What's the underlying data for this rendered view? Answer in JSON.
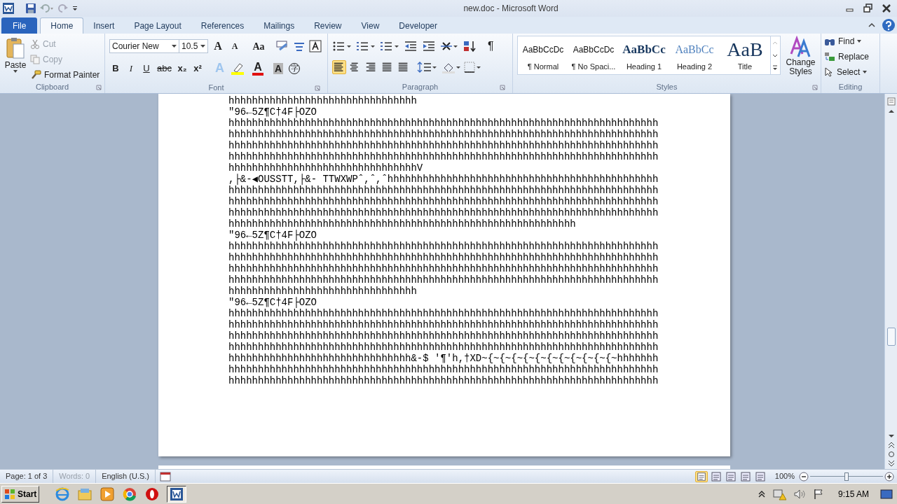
{
  "window": {
    "title": "new.doc - Microsoft Word"
  },
  "tabs": [
    {
      "label": "File",
      "kind": "file",
      "selected": false
    },
    {
      "label": "Home",
      "kind": "tab",
      "selected": true
    },
    {
      "label": "Insert",
      "kind": "tab",
      "selected": false
    },
    {
      "label": "Page Layout",
      "kind": "tab",
      "selected": false
    },
    {
      "label": "References",
      "kind": "tab",
      "selected": false
    },
    {
      "label": "Mailings",
      "kind": "tab",
      "selected": false
    },
    {
      "label": "Review",
      "kind": "tab",
      "selected": false
    },
    {
      "label": "View",
      "kind": "tab",
      "selected": false
    },
    {
      "label": "Developer",
      "kind": "tab",
      "selected": false
    }
  ],
  "clipboard": {
    "label": "Clipboard",
    "paste": "Paste",
    "cut": {
      "label": "Cut",
      "disabled": true
    },
    "copy": {
      "label": "Copy",
      "disabled": true
    },
    "format_painter": {
      "label": "Format Painter",
      "disabled": false
    }
  },
  "font": {
    "label": "Font",
    "name": "Courier New",
    "size": "10.5",
    "grow": "A",
    "shrink": "A",
    "change_case": "Aa",
    "format_buttons": [
      "B",
      "I",
      "U",
      "abc",
      "x₂",
      "x²"
    ],
    "effects": "A",
    "font_color_button": "A",
    "shading": "A",
    "enclose": "字"
  },
  "paragraph": {
    "label": "Paragraph",
    "alignments": [
      {
        "selected": true
      },
      {
        "selected": false
      },
      {
        "selected": false
      },
      {
        "selected": false
      },
      {
        "selected": false
      }
    ],
    "show_marks": "¶"
  },
  "styles": {
    "label": "Styles",
    "gallery": [
      {
        "preview": "AaBbCcDc",
        "name": "¶ Normal",
        "kind": "body"
      },
      {
        "preview": "AaBbCcDc",
        "name": "¶ No Spaci...",
        "kind": "body"
      },
      {
        "preview": "AaBbCc",
        "name": "Heading 1",
        "kind": "heading1"
      },
      {
        "preview": "AaBbCc",
        "name": "Heading 2",
        "kind": "heading2"
      },
      {
        "preview": "AaB",
        "name": "Title",
        "kind": "title"
      }
    ],
    "change_styles": [
      "Change",
      "Styles"
    ]
  },
  "editing": {
    "label": "Editing",
    "find": "Find",
    "replace": "Replace",
    "select": "Select"
  },
  "document": {
    "lines": [
      "hhhhhhhhhhhhhhhhhhhhhhhhhhhhhhhh",
      "\"96←5Z¶C†4F├OZO",
      "hhhhhhhhhhhhhhhhhhhhhhhhhhhhhhhhhhhhhhhhhhhhhhhhhhhhhhhhhhhhhhhhhhhhhhhhh",
      "hhhhhhhhhhhhhhhhhhhhhhhhhhhhhhhhhhhhhhhhhhhhhhhhhhhhhhhhhhhhhhhhhhhhhhhhh",
      "hhhhhhhhhhhhhhhhhhhhhhhhhhhhhhhhhhhhhhhhhhhhhhhhhhhhhhhhhhhhhhhhhhhhhhhhh",
      "hhhhhhhhhhhhhhhhhhhhhhhhhhhhhhhhhhhhhhhhhhhhhhhhhhhhhhhhhhhhhhhhhhhhhhhhh",
      "hhhhhhhhhhhhhhhhhhhhhhhhhhhhhhhhV",
      ",├&-◀OUSSTT,├&- TTWXWPˆ,ˆ,ˆhhhhhhhhhhhhhhhhhhhhhhhhhhhhhhhhhhhhhhhhhhhhhh",
      "hhhhhhhhhhhhhhhhhhhhhhhhhhhhhhhhhhhhhhhhhhhhhhhhhhhhhhhhhhhhhhhhhhhhhhhhh",
      "hhhhhhhhhhhhhhhhhhhhhhhhhhhhhhhhhhhhhhhhhhhhhhhhhhhhhhhhhhhhhhhhhhhhhhhhh",
      "hhhhhhhhhhhhhhhhhhhhhhhhhhhhhhhhhhhhhhhhhhhhhhhhhhhhhhhhhhhhhhhhhhhhhhhhh",
      "hhhhhhhhhhhhhhhhhhhhhhhhhhhhhhhhhhhhhhhhhhhhhhhhhhhhhhhhhhh",
      "\"96←5Z¶C†4F├OZO",
      "hhhhhhhhhhhhhhhhhhhhhhhhhhhhhhhhhhhhhhhhhhhhhhhhhhhhhhhhhhhhhhhhhhhhhhhhh",
      "hhhhhhhhhhhhhhhhhhhhhhhhhhhhhhhhhhhhhhhhhhhhhhhhhhhhhhhhhhhhhhhhhhhhhhhhh",
      "hhhhhhhhhhhhhhhhhhhhhhhhhhhhhhhhhhhhhhhhhhhhhhhhhhhhhhhhhhhhhhhhhhhhhhhhh",
      "hhhhhhhhhhhhhhhhhhhhhhhhhhhhhhhhhhhhhhhhhhhhhhhhhhhhhhhhhhhhhhhhhhhhhhhhh",
      "hhhhhhhhhhhhhhhhhhhhhhhhhhhhhhhh",
      "\"96←5Z¶C†4F├OZO",
      "hhhhhhhhhhhhhhhhhhhhhhhhhhhhhhhhhhhhhhhhhhhhhhhhhhhhhhhhhhhhhhhhhhhhhhhhh",
      "hhhhhhhhhhhhhhhhhhhhhhhhhhhhhhhhhhhhhhhhhhhhhhhhhhhhhhhhhhhhhhhhhhhhhhhhh",
      "hhhhhhhhhhhhhhhhhhhhhhhhhhhhhhhhhhhhhhhhhhhhhhhhhhhhhhhhhhhhhhhhhhhhhhhhh",
      "hhhhhhhhhhhhhhhhhhhhhhhhhhhhhhhhhhhhhhhhhhhhhhhhhhhhhhhhhhhhhhhhhhhhhhhhh",
      "hhhhhhhhhhhhhhhhhhhhhhhhhhhhhhh&-$ '¶'h,†XD~{~{~{~{~{~{~{~{~{~{~{~hhhhhhh",
      "hhhhhhhhhhhhhhhhhhhhhhhhhhhhhhhhhhhhhhhhhhhhhhhhhhhhhhhhhhhhhhhhhhhhhhhhh",
      "hhhhhhhhhhhhhhhhhhhhhhhhhhhhhhhhhhhhhhhhhhhhhhhhhhhhhhhhhhhhhhhhhhhhhhhhh"
    ]
  },
  "status_bar": {
    "page": "Page: 1 of 3",
    "words": {
      "label": "Words: 0",
      "disabled": true
    },
    "language": "English (U.S.)",
    "zoom": "100%",
    "zoom_level": {
      "level": 0.5
    }
  },
  "taskbar": {
    "start": "Start",
    "clock": "9:15 AM"
  }
}
